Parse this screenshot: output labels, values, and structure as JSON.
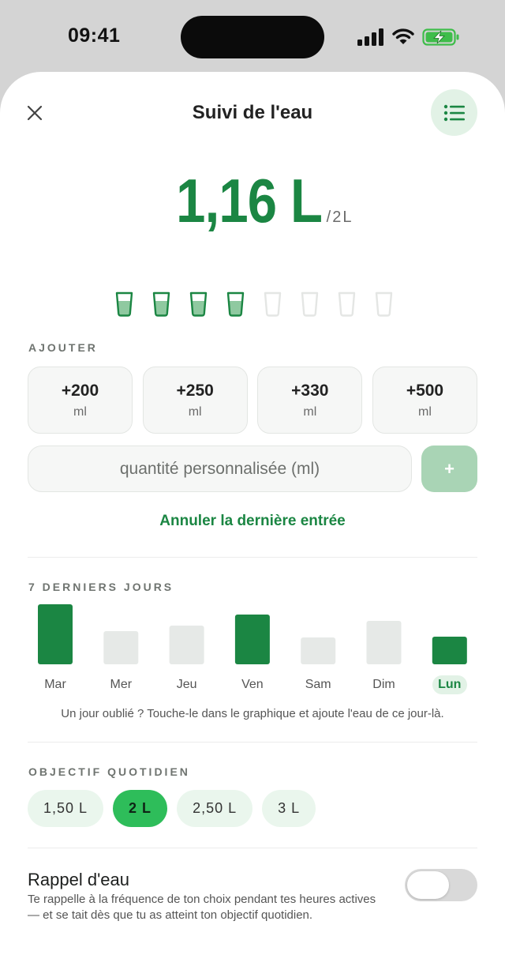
{
  "status_bar": {
    "time": "09:41",
    "signal_icon": "cellular-signal-icon",
    "wifi_icon": "wifi-icon",
    "battery_icon": "battery-charging-icon"
  },
  "header": {
    "title": "Suivi de l'eau",
    "close_icon": "close-icon",
    "history_icon": "list-icon"
  },
  "intake": {
    "total": "1,16 L",
    "goal": "/2L",
    "glasses_total": 8,
    "glasses_filled": 4
  },
  "add": {
    "label": "AJOUTER",
    "buttons": [
      {
        "amount": "+200",
        "unit": "ml"
      },
      {
        "amount": "+250",
        "unit": "ml"
      },
      {
        "amount": "+330",
        "unit": "ml"
      },
      {
        "amount": "+500",
        "unit": "ml"
      }
    ],
    "custom_placeholder": "quantité personnalisée (ml)",
    "custom_add_label": "+",
    "undo_label": "Annuler la dernière entrée"
  },
  "history": {
    "label": "7 DERNIERS JOURS",
    "hint": "Un jour oublié ? Touche-le dans le graphique et ajoute l'eau de ce jour-là."
  },
  "chart_data": {
    "type": "bar",
    "categories": [
      "Mar",
      "Mer",
      "Jeu",
      "Ven",
      "Sam",
      "Dim",
      "Lun"
    ],
    "values": [
      2.0,
      1.1,
      1.3,
      1.65,
      0.9,
      1.45,
      0.92
    ],
    "goal_reached": [
      true,
      false,
      false,
      true,
      false,
      false,
      true
    ],
    "highlighted": "Lun",
    "colors": {
      "reached": "#1b8643",
      "not_reached": "#e6e9e7"
    }
  },
  "goal": {
    "label": "OBJECTIF QUOTIDIEN",
    "options": [
      "1,50 L",
      "2 L",
      "2,50 L",
      "3 L"
    ],
    "selected": "2 L"
  },
  "reminder": {
    "title": "Rappel d'eau",
    "description": "Te rappelle à la fréquence de ton choix pendant tes heures actives — et se tait dès que tu as atteint ton objectif quotidien.",
    "enabled": false
  },
  "colors": {
    "accent": "#1b8643",
    "accent_light": "#e2f2e6",
    "chip_active": "#2ebd5a"
  }
}
